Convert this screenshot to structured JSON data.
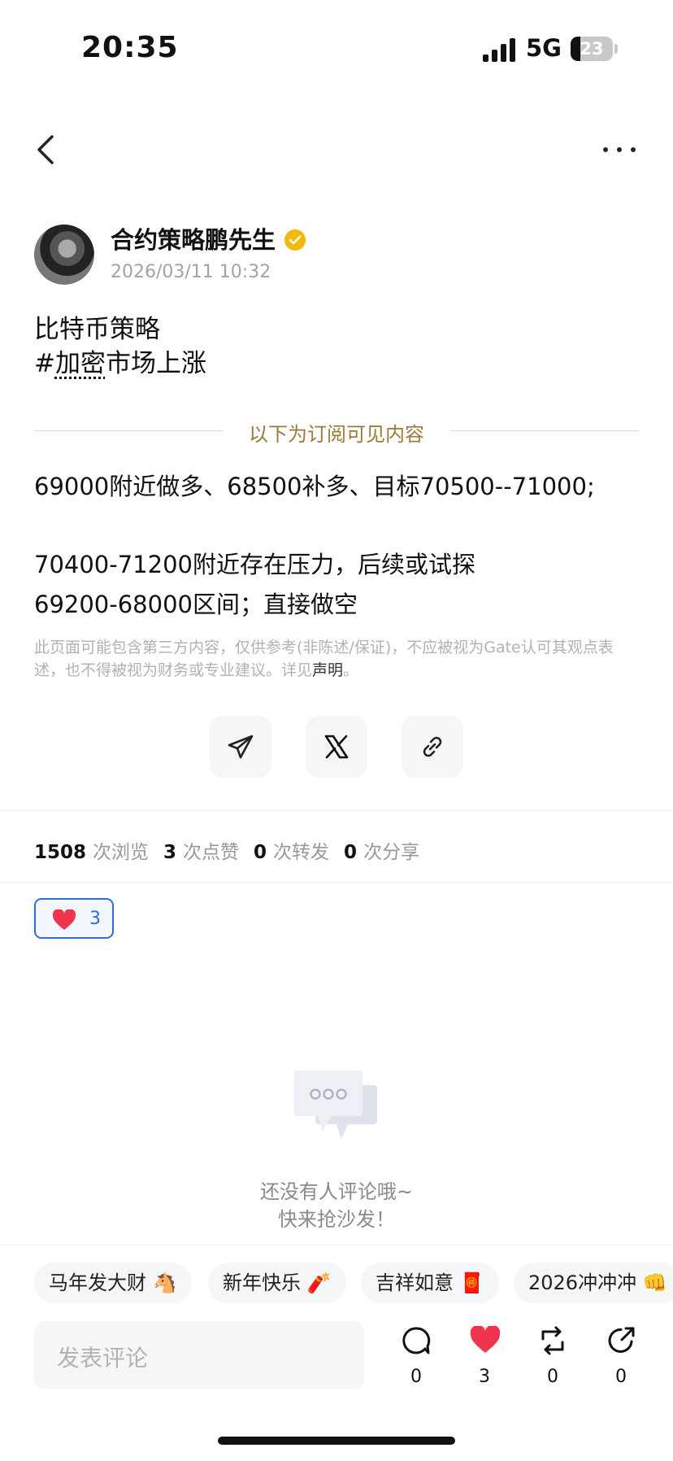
{
  "status_bar": {
    "time": "20:35",
    "network": "5G",
    "battery": "23",
    "battery_level": 0.23
  },
  "author": {
    "name": "合约策略鹏先生",
    "date": "2026/03/11 10:32",
    "verified": true
  },
  "post": {
    "title": "比特币策略",
    "tag_hash": "#",
    "tag_text": "加密",
    "tag_rest": "市场上涨",
    "subscriber_divider": "以下为订阅可见内容",
    "lines": [
      "69000附近做多、68500补多、目标70500--71000;",
      "70400-71200附近存在压力，后续或试探",
      "69200-68000区间；直接做空"
    ],
    "disclaimer": "此页面可能包含第三方内容，仅供参考(非陈述/保证)，不应被视为Gate认可其观点表述，也不得被视为财务或专业建议。详见",
    "disclaimer_link": "声明",
    "disclaimer_end": "。"
  },
  "share": {
    "icons": [
      "telegram-icon",
      "x-icon",
      "link-icon"
    ]
  },
  "stats": {
    "views": "1508",
    "views_label": "次浏览",
    "likes": "3",
    "likes_label": "次点赞",
    "reposts": "0",
    "reposts_label": "次转发",
    "shares": "0",
    "shares_label": "次分享"
  },
  "reaction": {
    "emoji": "heart-icon",
    "count": "3"
  },
  "empty_state": {
    "line1": "还没有人评论哦~",
    "line2": "快来抢沙发！"
  },
  "quick_replies": [
    "马年发大财 🐴",
    "新年快乐 🧨",
    "吉祥如意 🧧",
    "2026冲冲冲 👊"
  ],
  "bottom_bar": {
    "comment_placeholder": "发表评论",
    "comments": "0",
    "likes": "3",
    "reposts": "0",
    "shares": "0"
  },
  "colors": {
    "accent_blue": "#2f6fdb",
    "heart_red": "#f0344e",
    "gold": "#9a7b38",
    "verified": "#f0b90b"
  }
}
